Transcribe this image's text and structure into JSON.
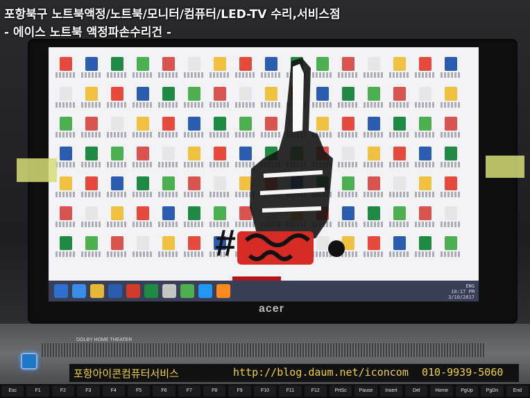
{
  "caption": {
    "line1": "포항북구 노트북액정/노트북/모니터/컴퓨터/LED-TV 수리,서비스점",
    "line2": "- 에이스 노트북 액정파손수리건 -"
  },
  "laptop": {
    "brand_logo": "acer",
    "dolby_label": "DOLBY HOME THEATER",
    "tray_time": "10:17 PM",
    "tray_date": "3/10/2017",
    "tray_lang": "ENG"
  },
  "footer": {
    "shop_name": "포항아이콘컴퓨터서비스",
    "url": "http://blog.daum.net/iconcom",
    "phone": "010-9939-5060"
  },
  "keyboard": {
    "keys": [
      "Esc",
      "F1",
      "F2",
      "F3",
      "F4",
      "F5",
      "F6",
      "F7",
      "F8",
      "F9",
      "F10",
      "F11",
      "F12",
      "PrtSc",
      "Pause Break",
      "Insert",
      "Del",
      "Home",
      "PgUp",
      "PgDn",
      "End"
    ]
  },
  "colors": {
    "footer_text": "#f2d33a",
    "screen_bg": "#f3f3f5",
    "taskbar": "#3a3f58",
    "tape": "#d6dc78",
    "power_led": "#1e78c8"
  }
}
